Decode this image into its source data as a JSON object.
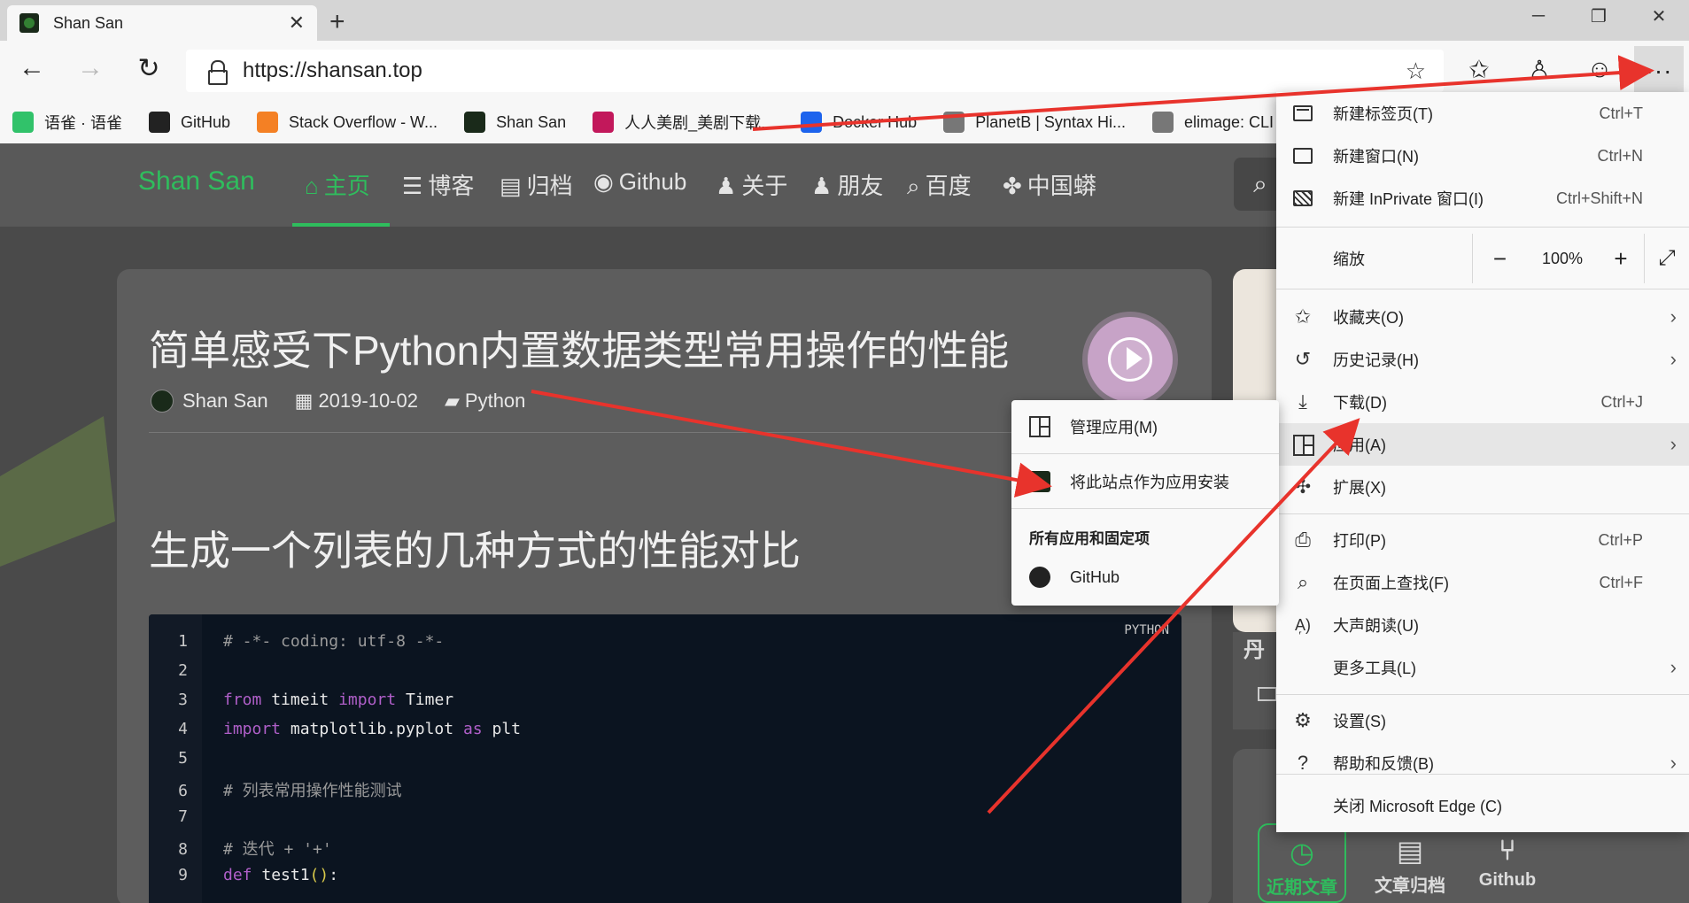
{
  "browser": {
    "tab_title": "Shan San",
    "url": "https://shansan.top",
    "window_controls": [
      "─",
      "❐",
      "✕"
    ],
    "bookmarks": [
      {
        "label": "语雀 · 语雀",
        "color": "#31c26a"
      },
      {
        "label": "GitHub",
        "color": "#222222"
      },
      {
        "label": "Stack Overflow - W...",
        "color": "#f48024"
      },
      {
        "label": "Shan San",
        "color": "#1a2a1a"
      },
      {
        "label": "人人美剧_美剧下载...",
        "color": "#c2185b"
      },
      {
        "label": "Docker Hub",
        "color": "#1d63ed"
      },
      {
        "label": "PlanetB | Syntax Hi...",
        "color": "#777777"
      },
      {
        "label": "elimage: CLI image ...",
        "color": "#777777"
      }
    ]
  },
  "site": {
    "brand": "Shan San",
    "nav": [
      {
        "icon": "home-icon",
        "glyph": "⌂",
        "label": "主页"
      },
      {
        "icon": "rss-icon",
        "glyph": "☰",
        "label": "博客"
      },
      {
        "icon": "archive-icon",
        "glyph": "▤",
        "label": "归档"
      },
      {
        "icon": "github-icon",
        "glyph": "◉",
        "label": "Github"
      },
      {
        "icon": "user-icon",
        "glyph": "♟",
        "label": "关于"
      },
      {
        "icon": "users-icon",
        "glyph": "♟",
        "label": "朋友"
      },
      {
        "icon": "search-icon",
        "glyph": "⌕",
        "label": "百度"
      },
      {
        "icon": "paw-icon",
        "glyph": "✤",
        "label": "中国蟒"
      }
    ],
    "accent": "#2fbd5d"
  },
  "post": {
    "title": "简单感受下Python内置数据类型常用操作的性能",
    "author": "Shan San",
    "date": "2019-10-02",
    "category": "Python",
    "h2": "生成一个列表的几种方式的性能对比",
    "code_lang": "PYTHON",
    "code_lines": [
      "# -*- coding: utf-8 -*-",
      "",
      "from timeit import Timer",
      "import matplotlib.pyplot as plt",
      "",
      "# 列表常用操作性能测试",
      "",
      "# 迭代 + '+'",
      "def test1():"
    ]
  },
  "sidebar": {
    "partial_title": "丹",
    "tabs": [
      "近期文章",
      "文章归档",
      "Github"
    ]
  },
  "menu": {
    "items": [
      {
        "label": "新建标签页(T)",
        "shortcut": "Ctrl+T"
      },
      {
        "label": "新建窗口(N)",
        "shortcut": "Ctrl+N"
      },
      {
        "label": "新建 InPrivate 窗口(I)",
        "shortcut": "Ctrl+Shift+N"
      },
      {
        "label": "缩放",
        "zoom": "100%"
      },
      {
        "label": "收藏夹(O)"
      },
      {
        "label": "历史记录(H)"
      },
      {
        "label": "下载(D)",
        "shortcut": "Ctrl+J"
      },
      {
        "label": "应用(A)"
      },
      {
        "label": "扩展(X)"
      },
      {
        "label": "打印(P)",
        "shortcut": "Ctrl+P"
      },
      {
        "label": "在页面上查找(F)",
        "shortcut": "Ctrl+F"
      },
      {
        "label": "大声朗读(U)"
      },
      {
        "label": "更多工具(L)"
      },
      {
        "label": "设置(S)"
      },
      {
        "label": "帮助和反馈(B)"
      },
      {
        "label": "关闭 Microsoft Edge (C)"
      }
    ]
  },
  "submenu": {
    "manage": "管理应用(M)",
    "install": "将此站点作为应用安装",
    "section_header": "所有应用和固定项",
    "app_github": "GitHub"
  },
  "annotation_color": "#e8332c"
}
